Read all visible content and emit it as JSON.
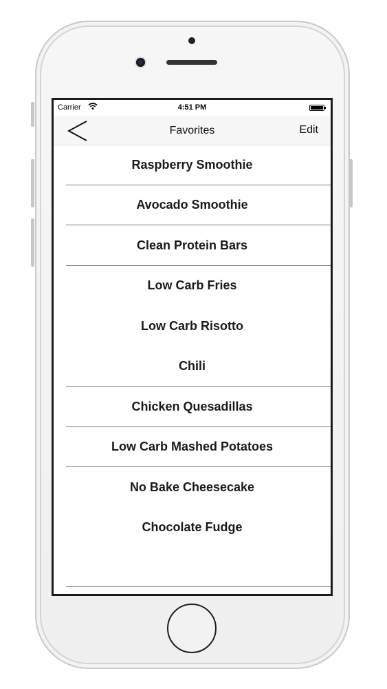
{
  "status_bar": {
    "carrier": "Carrier",
    "time": "4:51 PM"
  },
  "nav": {
    "title": "Favorites",
    "edit_label": "Edit"
  },
  "favorites": [
    "Raspberry Smoothie",
    "Avocado Smoothie",
    "Clean Protein Bars",
    "Low Carb Fries",
    "Low Carb Risotto",
    "Chili",
    "Chicken Quesadillas",
    "Low Carb Mashed Potatoes",
    "No Bake Cheesecake",
    "Chocolate Fudge"
  ]
}
